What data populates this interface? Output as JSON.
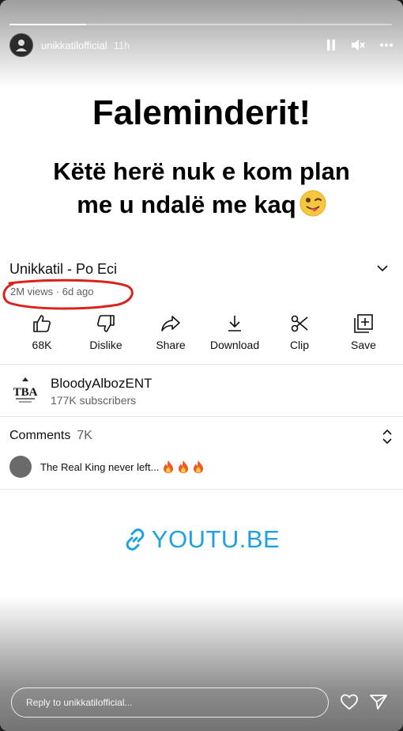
{
  "story": {
    "username": "unikkatilofficial",
    "time": "11h",
    "progress": 0.2,
    "headline": "Faleminderit!",
    "subline1": "Këtë herë nuk e kom plan",
    "subline2": "me u ndalë me kaq",
    "emoji_icon": "winking-face-with-tongue-icon",
    "reply_placeholder": "Reply to unikkatilofficial..."
  },
  "video": {
    "title": "Unikkatil - Po Eci",
    "meta": "2M views · 6d ago",
    "highlight_color": "#d9241c",
    "actions": [
      {
        "label": "68K",
        "icon": "thumbs-up-icon"
      },
      {
        "label": "Dislike",
        "icon": "thumbs-down-icon"
      },
      {
        "label": "Share",
        "icon": "share-icon"
      },
      {
        "label": "Download",
        "icon": "download-icon"
      },
      {
        "label": "Clip",
        "icon": "scissors-icon"
      },
      {
        "label": "Save",
        "icon": "add-to-playlist-icon"
      }
    ]
  },
  "channel": {
    "name": "BloodyAlbozENT",
    "subscribers": "177K subscribers",
    "logo_text": "TBA"
  },
  "comments": {
    "label": "Comments",
    "count": "7K",
    "top_comment": "The Real King never left...",
    "reaction_icon": "fire-icon"
  },
  "link": {
    "text": "YOUTU.BE",
    "color": "#1da1e4"
  }
}
